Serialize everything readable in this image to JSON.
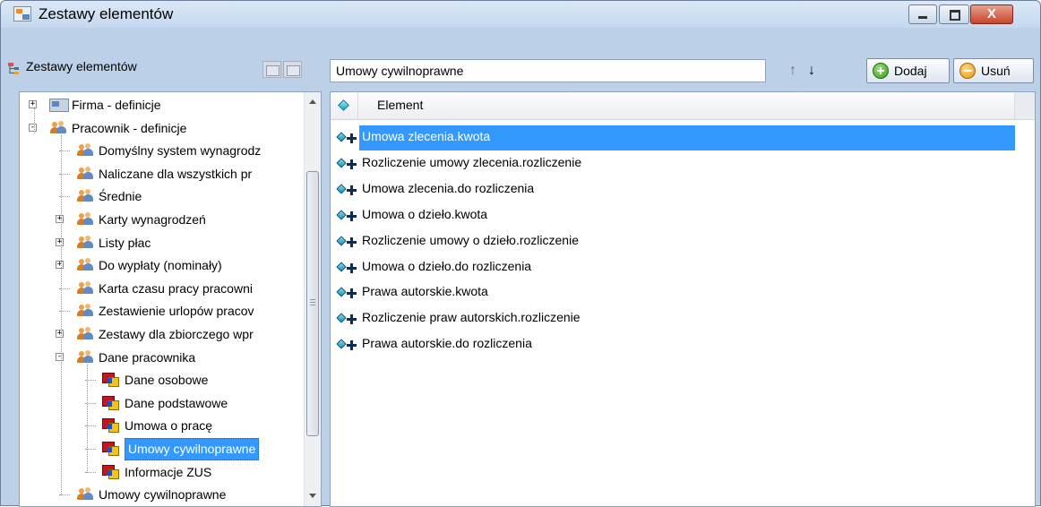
{
  "window": {
    "title": "Zestawy elementów",
    "close_symbol": "X"
  },
  "left_pane": {
    "title": "Zestawy elementów",
    "tree": [
      {
        "label": "Firma - definicje",
        "level": 0,
        "icon": "firm",
        "expander": "+"
      },
      {
        "label": "Pracownik - definicje",
        "level": 0,
        "icon": "people",
        "expander": "−"
      },
      {
        "label": "Domyślny system wynagrodz",
        "level": 1,
        "icon": "people",
        "expander": ""
      },
      {
        "label": "Naliczane dla wszystkich pr",
        "level": 1,
        "icon": "people",
        "expander": ""
      },
      {
        "label": "Średnie",
        "level": 1,
        "icon": "people",
        "expander": ""
      },
      {
        "label": "Karty wynagrodzeń",
        "level": 1,
        "icon": "people",
        "expander": "+"
      },
      {
        "label": "Listy płac",
        "level": 1,
        "icon": "people",
        "expander": "+"
      },
      {
        "label": "Do wypłaty (nominały)",
        "level": 1,
        "icon": "people",
        "expander": "+"
      },
      {
        "label": "Karta czasu pracy pracowni",
        "level": 1,
        "icon": "people",
        "expander": ""
      },
      {
        "label": "Zestawienie urlopów pracov",
        "level": 1,
        "icon": "people",
        "expander": ""
      },
      {
        "label": "Zestawy dla zbiorczego wpr",
        "level": 1,
        "icon": "people",
        "expander": "+"
      },
      {
        "label": "Dane pracownika",
        "level": 1,
        "icon": "people",
        "expander": "−"
      },
      {
        "label": "Dane osobowe",
        "level": 2,
        "icon": "form",
        "expander": ""
      },
      {
        "label": "Dane podstawowe",
        "level": 2,
        "icon": "form",
        "expander": ""
      },
      {
        "label": "Umowa o pracę",
        "level": 2,
        "icon": "form",
        "expander": ""
      },
      {
        "label": "Umowy cywilnoprawne",
        "level": 2,
        "icon": "form",
        "expander": "",
        "selected": true
      },
      {
        "label": "Informacje ZUS",
        "level": 2,
        "icon": "form",
        "expander": ""
      },
      {
        "label": "Umowy cywilnoprawne",
        "level": 1,
        "icon": "people",
        "expander": ""
      }
    ]
  },
  "toolbar": {
    "set_name": "Umowy cywilnoprawne",
    "up_arrow": "↑",
    "down_arrow": "↓",
    "add_label": "Dodaj",
    "remove_label": "Usuń"
  },
  "list": {
    "column_header": "Element",
    "items": [
      {
        "label": "Umowa zlecenia.kwota",
        "selected": true
      },
      {
        "label": "Rozliczenie umowy zlecenia.rozliczenie"
      },
      {
        "label": "Umowa zlecenia.do rozliczenia"
      },
      {
        "label": "Umowa o dzieło.kwota"
      },
      {
        "label": "Rozliczenie umowy o dzieło.rozliczenie"
      },
      {
        "label": "Umowa o dzieło.do rozliczenia"
      },
      {
        "label": "Prawa autorskie.kwota"
      },
      {
        "label": "Rozliczenie praw autorskich.rozliczenie"
      },
      {
        "label": "Prawa autorskie.do rozliczenia"
      }
    ]
  },
  "colors": {
    "selection": "#3399ff",
    "window_bg": "#bcd0e8"
  }
}
